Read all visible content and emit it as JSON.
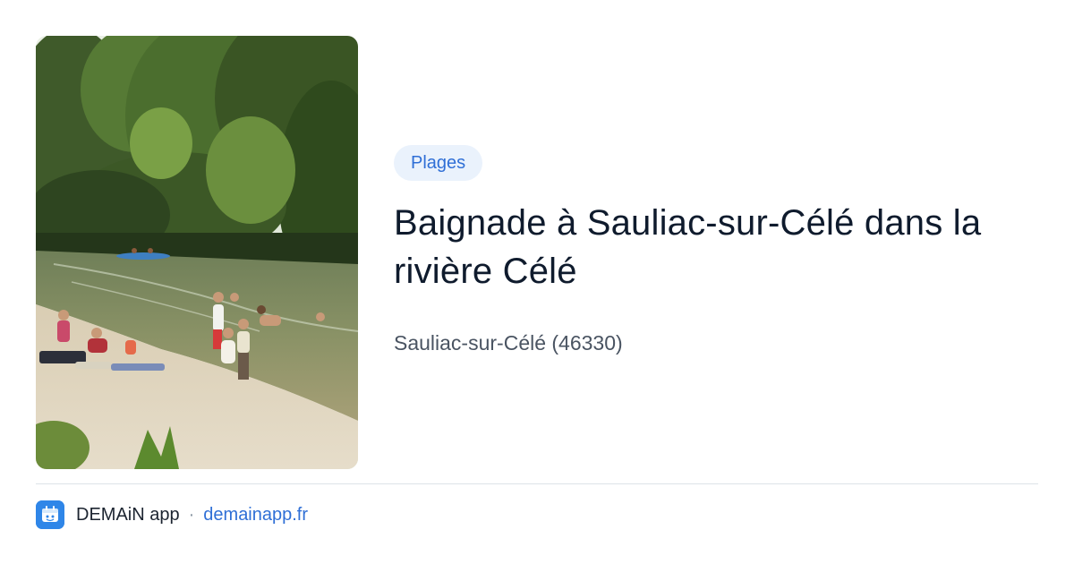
{
  "card": {
    "category": "Plages",
    "title": "Baignade à Sauliac-sur-Célé dans la rivière Célé",
    "location": "Sauliac-sur-Célé (46330)",
    "image": "river-beach-photo"
  },
  "footer": {
    "app_name": "DEMAiN app",
    "separator": "·",
    "domain": "demainapp.fr",
    "icon": "demain-app-icon"
  },
  "colors": {
    "accent": "#2f6fd6",
    "tag_bg": "#eaf2fc",
    "app_icon": "#2f86e8"
  }
}
